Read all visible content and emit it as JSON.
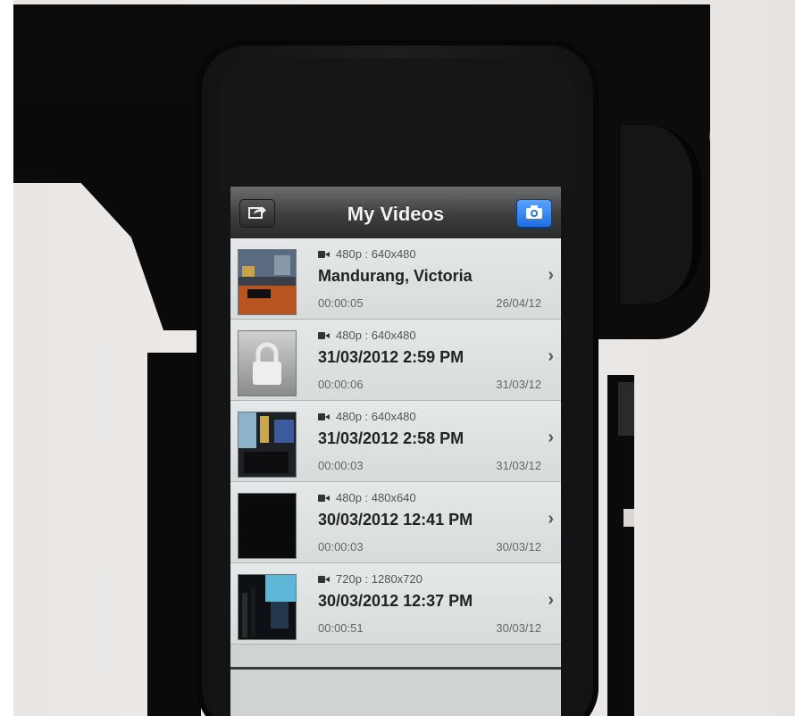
{
  "navbar": {
    "title": "My Videos",
    "left_icon": "share-icon",
    "right_icon": "camera-icon"
  },
  "videos": [
    {
      "meta": "480p : 640x480",
      "title": "Mandurang, Victoria",
      "duration": "00:00:05",
      "date": "26/04/12",
      "thumb": "photo-thumbnail"
    },
    {
      "meta": "480p : 640x480",
      "title": "31/03/2012 2:59 PM",
      "duration": "00:00:06",
      "date": "31/03/12",
      "thumb": "lock-icon"
    },
    {
      "meta": "480p : 640x480",
      "title": "31/03/2012 2:58 PM",
      "duration": "00:00:03",
      "date": "31/03/12",
      "thumb": "photo-thumbnail"
    },
    {
      "meta": "480p : 480x640",
      "title": "30/03/2012 12:41 PM",
      "duration": "00:00:03",
      "date": "30/03/12",
      "thumb": "black-thumbnail"
    },
    {
      "meta": "720p : 1280x720",
      "title": "30/03/2012 12:37 PM",
      "duration": "00:00:51",
      "date": "30/03/12",
      "thumb": "photo-thumbnail"
    }
  ],
  "colors": {
    "navbar": "#3d3e3f",
    "camera_button": "#1f6fe0",
    "list_background": "#dfe3e4"
  }
}
